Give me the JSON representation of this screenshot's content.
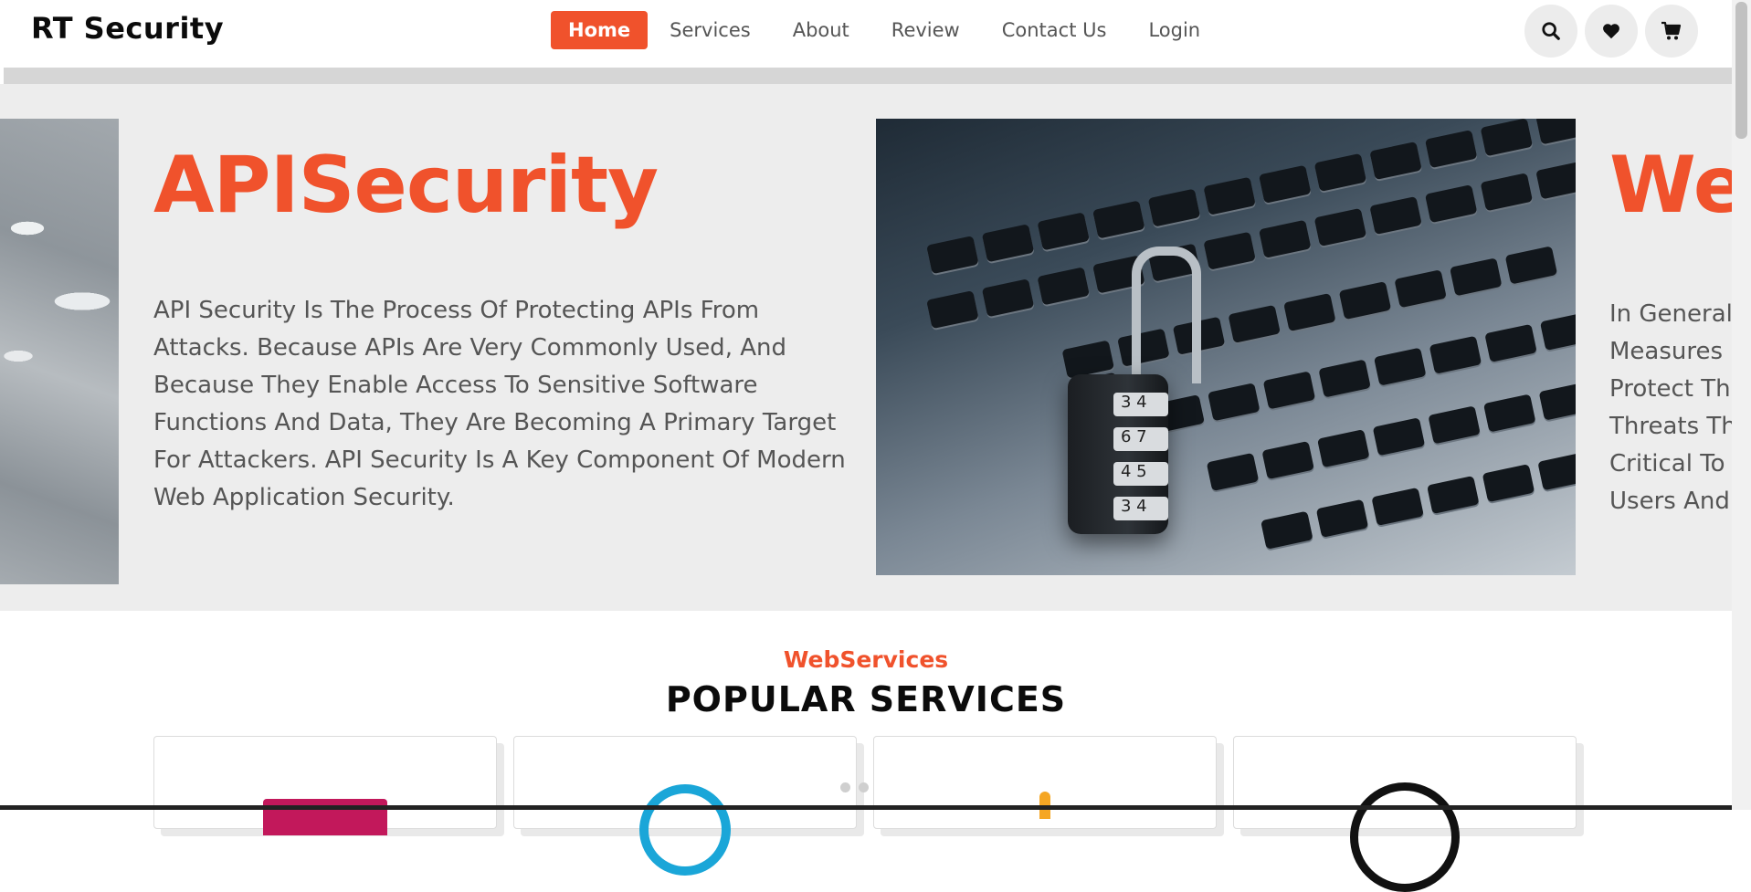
{
  "nav": {
    "brand": "RT Security",
    "links": [
      "Home",
      "Services",
      "About",
      "Review",
      "Contact Us",
      "Login"
    ],
    "icons": [
      "search-icon",
      "heart-icon",
      "cart-icon"
    ]
  },
  "hero": {
    "title": "APISecurity",
    "text": "API Security Is The Process Of Protecting APIs From Attacks. Because APIs Are Very Commonly Used, And Because They Enable Access To Sensitive Software Functions And Data, They Are Becoming A Primary Target For Attackers. API Security Is A Key Component Of Modern Web Application Security.",
    "lock_digits": [
      "3 4",
      "6 7",
      "4 5",
      "3 4"
    ],
    "next_title": "We",
    "next_text_lines": [
      "In General",
      "Measures",
      "Protect Th",
      "Threats Th",
      "Critical To",
      "Users And"
    ],
    "active_slide": 3,
    "slide_count": 3
  },
  "services": {
    "subtitle": "WebServices",
    "title": "POPULAR SERVICES"
  },
  "colors": {
    "accent": "#f0522c",
    "hero_bg": "#ededed",
    "text": "#555555"
  }
}
